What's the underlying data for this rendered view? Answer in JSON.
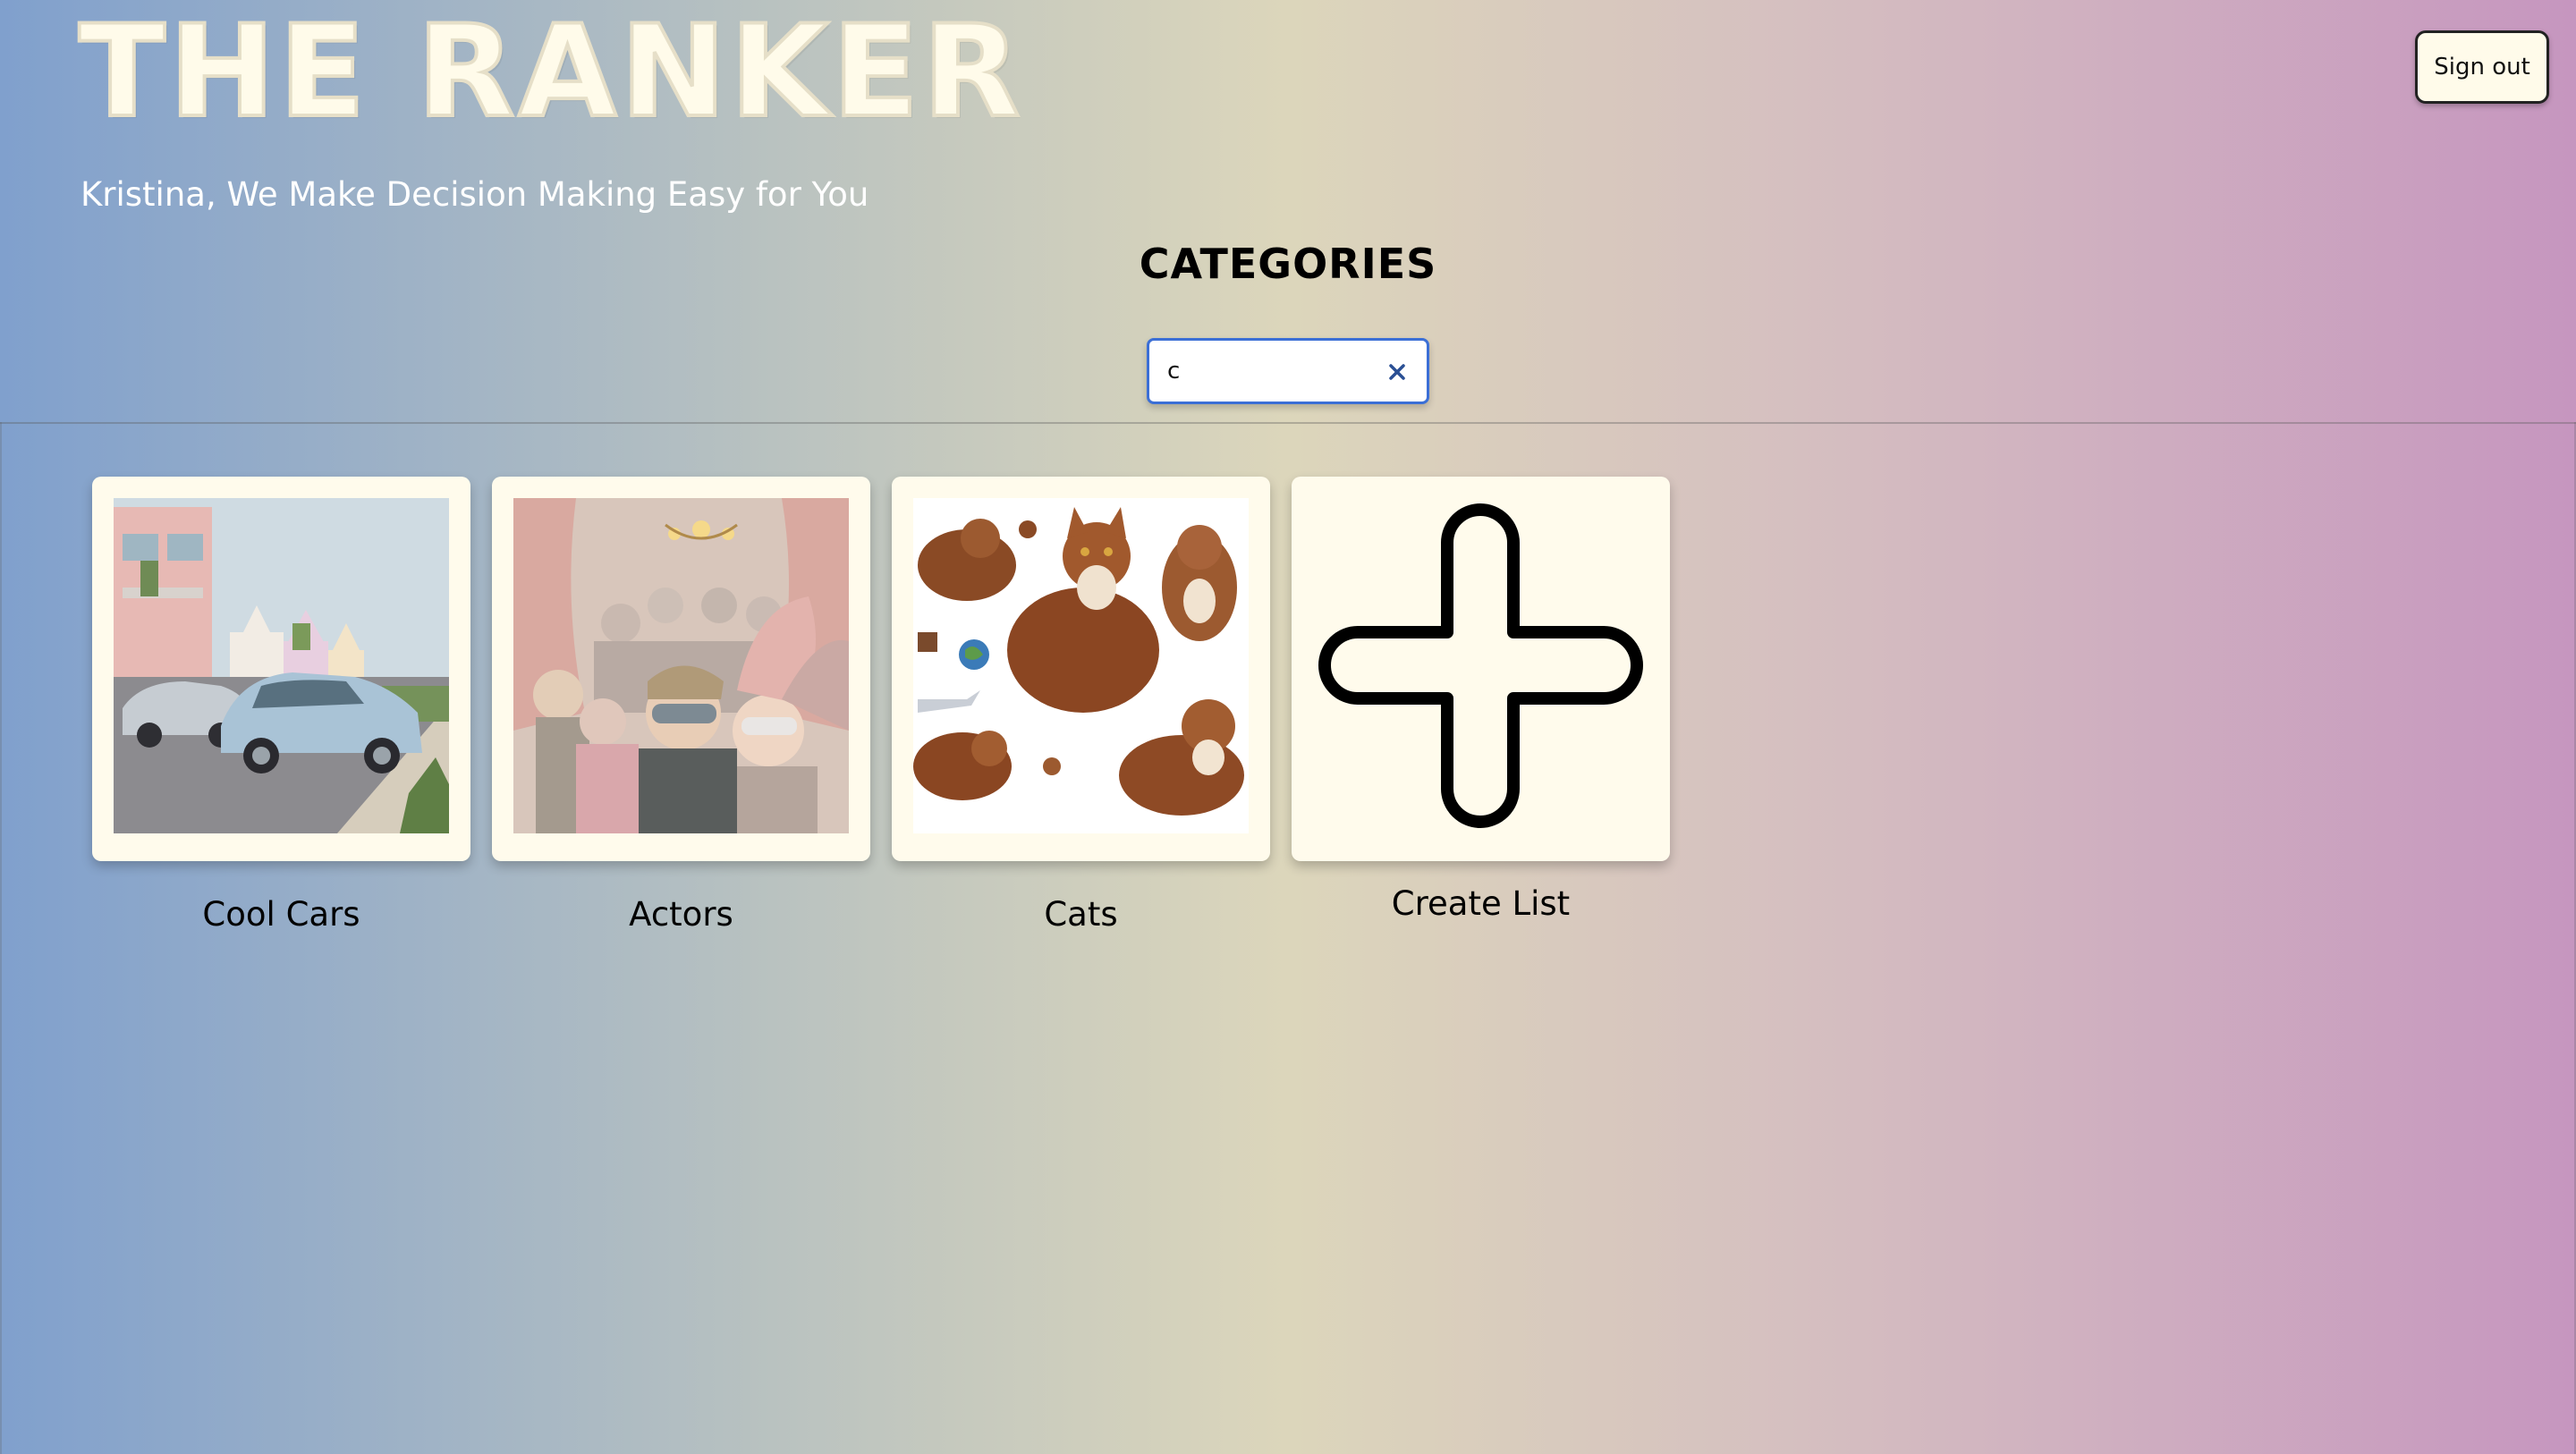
{
  "header": {
    "logo_text": "THE RANKER",
    "signout_label": "Sign out",
    "tagline": "Kristina, We Make Decision Making Easy for You"
  },
  "main": {
    "section_title": "CATEGORIES",
    "search": {
      "value": "c",
      "clear_icon": "close-icon"
    },
    "categories": [
      {
        "label": "Cool Cars",
        "image": "cars-photo"
      },
      {
        "label": "Actors",
        "image": "masquerade-photo"
      },
      {
        "label": "Cats",
        "image": "cats-stickers-photo"
      }
    ],
    "create_list": {
      "label": "Create List",
      "icon": "plus-icon"
    }
  },
  "colors": {
    "gradient": [
      "#80a0cd",
      "#dcd6bb",
      "#c696bf"
    ],
    "card_bg": "#fffbec",
    "accent": "#3b6fd6"
  }
}
